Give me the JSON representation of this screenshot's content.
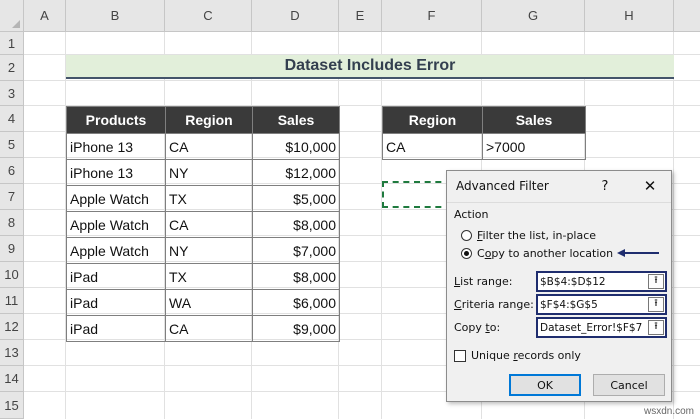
{
  "grid": {
    "columns": [
      "A",
      "B",
      "C",
      "D",
      "E",
      "F",
      "G",
      "H"
    ],
    "rows": [
      "1",
      "2",
      "3",
      "4",
      "5",
      "6",
      "7",
      "8",
      "9",
      "10",
      "11",
      "12",
      "13",
      "14",
      "15"
    ]
  },
  "title": "Dataset Includes Error",
  "main_table": {
    "headers": [
      "Products",
      "Region",
      "Sales"
    ],
    "rows": [
      [
        "iPhone 13",
        "CA",
        "$10,000"
      ],
      [
        "iPhone 13",
        "NY",
        "$12,000"
      ],
      [
        "Apple Watch",
        "TX",
        "$5,000"
      ],
      [
        "Apple Watch",
        "CA",
        "$8,000"
      ],
      [
        "Apple Watch",
        "NY",
        "$7,000"
      ],
      [
        "iPad",
        "TX",
        "$8,000"
      ],
      [
        "iPad",
        "WA",
        "$6,000"
      ],
      [
        "iPad",
        "CA",
        "$9,000"
      ]
    ]
  },
  "criteria_table": {
    "headers": [
      "Region",
      "Sales"
    ],
    "rows": [
      [
        "CA",
        ">7000"
      ]
    ]
  },
  "dialog": {
    "title": "Advanced Filter",
    "help": "?",
    "close": "✕",
    "action_label": "Action",
    "radio_filter_pre": "F",
    "radio_filter_rest": "ilter the list, in-place",
    "radio_copy_pre": "C",
    "radio_copy_mid": "o",
    "radio_copy_rest": "py to another location",
    "list_range_pre": "L",
    "list_range_rest": "ist range:",
    "list_range_value": "$B$4:$D$12",
    "criteria_range_pre": "C",
    "criteria_range_rest": "riteria range:",
    "criteria_range_value": "$F$4:$G$5",
    "copy_to_pre": "Copy ",
    "copy_to_u": "t",
    "copy_to_rest": "o:",
    "copy_to_value": "Dataset_Error!$F$7",
    "ref_icon": "⭱",
    "unique_pre": "Unique ",
    "unique_u": "r",
    "unique_rest": "ecords only",
    "ok": "OK",
    "cancel": "Cancel"
  },
  "watermark": "wsxdn.com",
  "colors": {
    "header_bg": "#3a3a3a",
    "title_bg": "#e2efda",
    "accent": "#1f2d6e",
    "marquee": "#1f7a3e"
  }
}
